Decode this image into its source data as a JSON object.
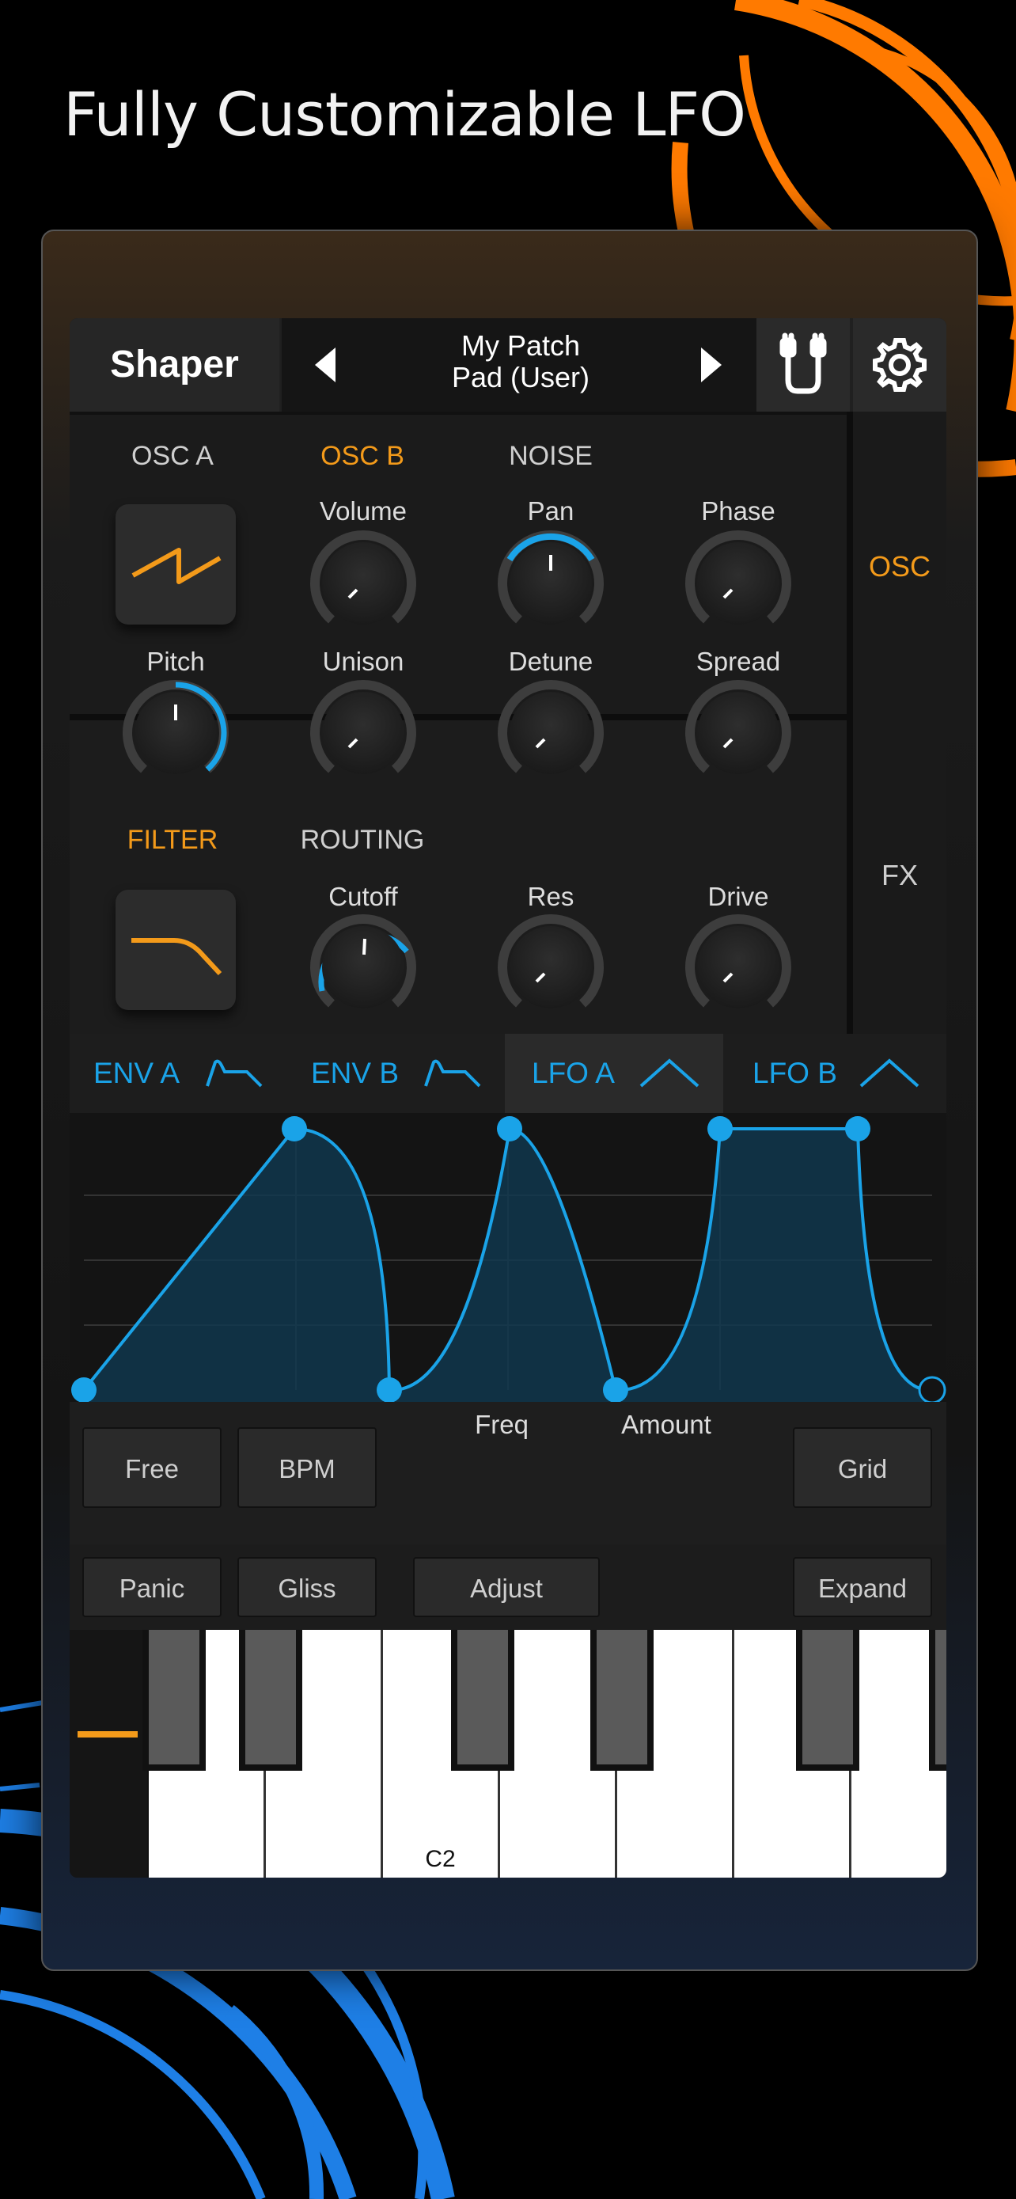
{
  "headline": "Fully Customizable LFO",
  "colors": {
    "accent_orange": "#f39a1a",
    "accent_blue": "#1aa3e8",
    "background": "#000000"
  },
  "header": {
    "title": "Shaper",
    "patch_name": "My Patch",
    "patch_bank": "Pad (User)",
    "prev_icon": "triangle-left-icon",
    "next_icon": "triangle-right-icon",
    "routing_icon": "cable-icon",
    "settings_icon": "gear-icon"
  },
  "osc_section": {
    "tabs": [
      "OSC A",
      "OSC B",
      "NOISE"
    ],
    "active_tab": "OSC B",
    "waveform_icon": "sawtooth-wave-icon",
    "knobs_row1": [
      "Volume",
      "Pan",
      "Phase"
    ],
    "knobs_row2": [
      "Pitch",
      "Unison",
      "Detune",
      "Spread"
    ]
  },
  "filter_section": {
    "tabs": [
      "FILTER",
      "ROUTING"
    ],
    "active_tab": "FILTER",
    "filter_icon": "lowpass-curve-icon",
    "knobs": [
      "Cutoff",
      "Res",
      "Drive"
    ]
  },
  "side_tabs": {
    "osc": "OSC",
    "fx": "FX",
    "active": "OSC"
  },
  "mod_tabs": [
    {
      "label": "ENV A",
      "icon": "envelope-icon"
    },
    {
      "label": "ENV B",
      "icon": "envelope-icon"
    },
    {
      "label": "LFO A",
      "icon": "lfo-triangle-icon"
    },
    {
      "label": "LFO B",
      "icon": "lfo-triangle-icon"
    }
  ],
  "active_mod_tab": "LFO A",
  "lfo_controls": {
    "free": "Free",
    "bpm": "BPM",
    "freq": "Freq",
    "amount": "Amount",
    "grid": "Grid"
  },
  "keyboard_controls": {
    "panic": "Panic",
    "gliss": "Gliss",
    "adjust": "Adjust",
    "expand": "Expand"
  },
  "keyboard": {
    "note_label": "C2"
  }
}
